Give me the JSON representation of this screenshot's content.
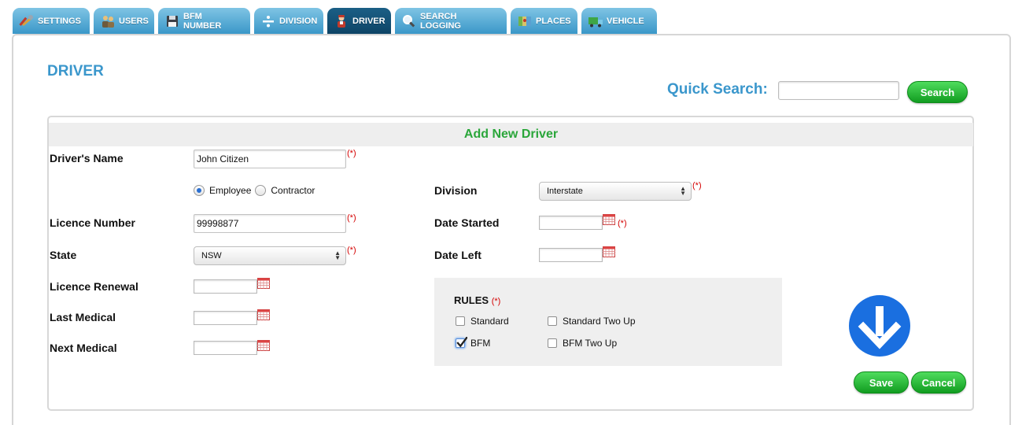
{
  "tabs": [
    {
      "label": "SETTINGS",
      "icon": "tools-icon"
    },
    {
      "label": "USERS",
      "icon": "users-icon"
    },
    {
      "label": "BFM NUMBER",
      "icon": "floppy-icon"
    },
    {
      "label": "DIVISION",
      "icon": "divide-icon"
    },
    {
      "label": "DRIVER",
      "icon": "driver-icon",
      "active": true
    },
    {
      "label": "SEARCH LOGGING",
      "icon": "magnifier-icon"
    },
    {
      "label": "PLACES",
      "icon": "map-icon"
    },
    {
      "label": "VEHICLE",
      "icon": "truck-icon"
    }
  ],
  "page": {
    "title": "DRIVER",
    "quick_search_label": "Quick Search:",
    "quick_search_value": "",
    "search_button": "Search"
  },
  "form": {
    "heading": "Add New Driver",
    "required_mark": "(*)",
    "drivers_name_label": "Driver's Name",
    "drivers_name_value": "John Citizen",
    "employment_options": [
      "Employee",
      "Contractor"
    ],
    "employment_selected": "Employee",
    "licence_number_label": "Licence Number",
    "licence_number_value": "99998877",
    "state_label": "State",
    "state_value": "NSW",
    "licence_renewal_label": "Licence Renewal",
    "last_medical_label": "Last Medical",
    "next_medical_label": "Next Medical",
    "division_label": "Division",
    "division_value": "Interstate",
    "date_started_label": "Date Started",
    "date_left_label": "Date Left",
    "rules_label": "RULES",
    "rules": [
      {
        "label": "Standard",
        "checked": false
      },
      {
        "label": "Standard Two Up",
        "checked": false
      },
      {
        "label": "BFM",
        "checked": true
      },
      {
        "label": "BFM Two Up",
        "checked": false
      }
    ],
    "save_button": "Save",
    "cancel_button": "Cancel"
  },
  "colors": {
    "tab_blue": "#3a97c8",
    "tab_active": "#0d4466",
    "title_blue": "#3b97cc",
    "heading_green": "#2aa63a",
    "button_green": "#119c20",
    "required_red": "#d40000",
    "arrow_blue": "#1a6fe0"
  }
}
